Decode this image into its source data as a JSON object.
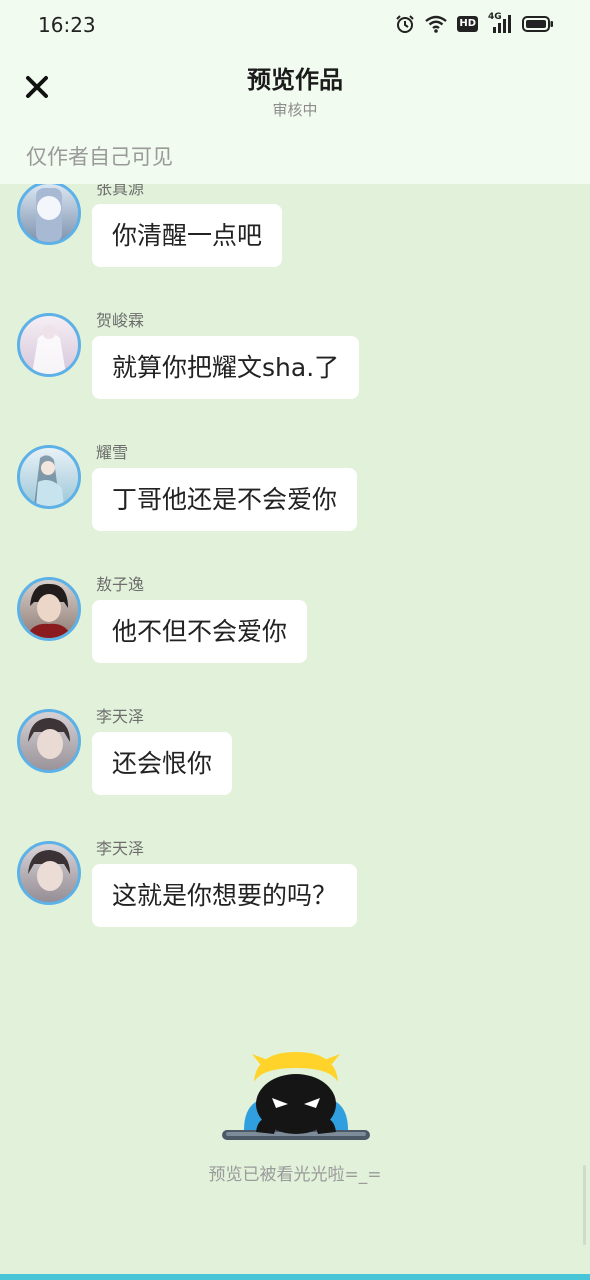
{
  "status_bar": {
    "time": "16:23",
    "icons": [
      "alarm-icon",
      "wifi-icon",
      "hd-icon",
      "cellular-4g-icon",
      "battery-icon"
    ],
    "hd_label": "HD",
    "network_label": "4G"
  },
  "nav": {
    "title": "预览作品",
    "subtitle": "审核中",
    "close_icon": "close-icon"
  },
  "visibility": {
    "text": "仅作者自己可见"
  },
  "colors": {
    "background": "#e2f2da",
    "header": "#f2fbef",
    "avatar_border": "#5db1e6",
    "bubble": "#ffffff",
    "bottom_strip": "#48c6d7"
  },
  "messages": [
    {
      "sender": "张真源",
      "text": "你清醒一点吧"
    },
    {
      "sender": "贺峻霖",
      "text": "就算你把耀文sha.了"
    },
    {
      "sender": "耀雪",
      "text": "丁哥他还是不会爱你"
    },
    {
      "sender": "敖子逸",
      "text": "他不但不会爱你"
    },
    {
      "sender": "李天泽",
      "text": "还会恨你"
    },
    {
      "sender": "李天泽",
      "text": "这就是你想要的吗？"
    }
  ],
  "footer": {
    "end_text": "预览已被看光光啦=_="
  }
}
